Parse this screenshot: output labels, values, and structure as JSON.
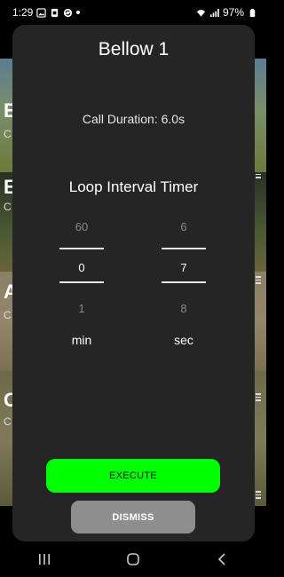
{
  "status_bar": {
    "time": "1:29",
    "battery": "97%",
    "icons": [
      "image-icon",
      "sim-icon",
      "sync-icon",
      "dot-icon",
      "wifi-icon",
      "signal-icon",
      "battery-icon"
    ]
  },
  "background_list": {
    "items": [
      {
        "title_initial": "E",
        "subtitle_initial": "C"
      },
      {
        "title_initial": "E",
        "subtitle_initial": "C"
      },
      {
        "title_initial": "A",
        "subtitle_initial": "C"
      },
      {
        "title_initial": "C",
        "subtitle_initial": "C"
      }
    ]
  },
  "dialog": {
    "title": "Bellow 1",
    "call_duration": "Call Duration: 6.0s",
    "timer_title": "Loop Interval Timer",
    "minutes_picker": {
      "prev": "60",
      "current": "0",
      "next": "1",
      "unit": "min"
    },
    "seconds_picker": {
      "prev": "6",
      "current": "7",
      "next": "8",
      "unit": "sec"
    },
    "execute_label": "EXECUTE",
    "dismiss_label": "DISMISS"
  },
  "nav_bar": {
    "icons": [
      "recent-apps-icon",
      "home-icon",
      "back-icon"
    ]
  },
  "colors": {
    "execute": "#00ff00",
    "dismiss": "#8e8e8e",
    "dialog_bg": "#252525"
  }
}
